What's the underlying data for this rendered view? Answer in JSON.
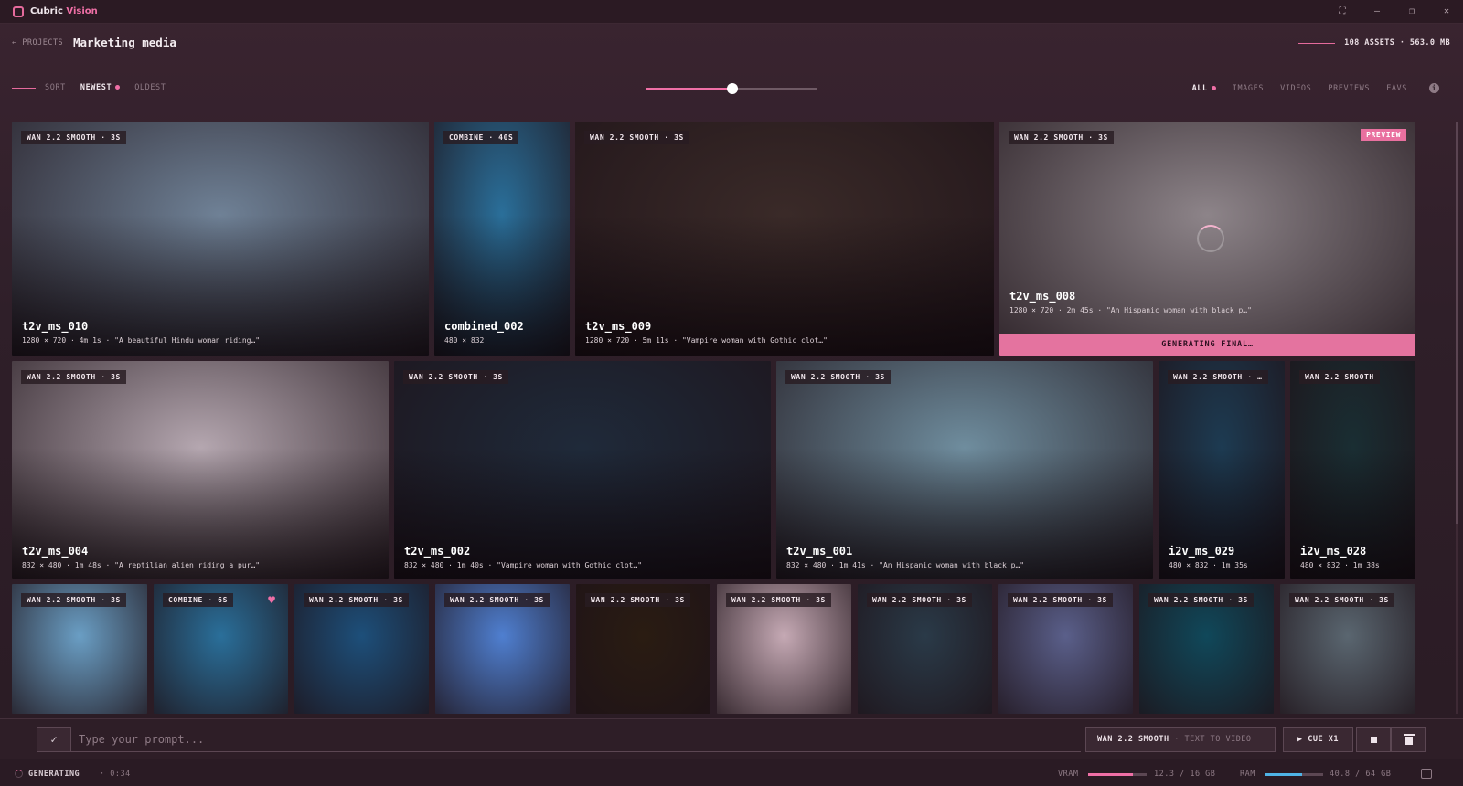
{
  "app": {
    "name_prefix": "Cubric",
    "name_accent": "Vision"
  },
  "header": {
    "back_label": "← PROJECTS",
    "title": "Marketing media",
    "summary": "108 ASSETS · 563.0 MB"
  },
  "sort": {
    "label": "SORT",
    "options": [
      "NEWEST",
      "OLDEST"
    ],
    "active": "NEWEST"
  },
  "thumbnail_size": {
    "value": 0.5
  },
  "filters": {
    "options": [
      "ALL",
      "IMAGES",
      "VIDEOS",
      "PREVIEWS",
      "FAVS"
    ],
    "active": "ALL"
  },
  "tiles": [
    {
      "badge": "WAN 2.2 SMOOTH · 3S",
      "name": "t2v_ms_010",
      "meta": "1280 × 720 · 4m 1s · \"A beautiful Hindu woman riding…\"",
      "bg": "#6f8196"
    },
    {
      "badge": "COMBINE · 40S",
      "name": "combined_002",
      "meta": "480 × 832",
      "bg": "#2a6f9a"
    },
    {
      "badge": "WAN 2.2 SMOOTH · 3S",
      "name": "t2v_ms_009",
      "meta": "1280 × 720 · 5m 11s · \"Vampire woman with Gothic clot…\"",
      "bg": "#3a2a28"
    },
    {
      "badge": "WAN 2.2 SMOOTH · 3S",
      "name": "t2v_ms_008",
      "meta": "1280 × 720 · 2m 45s · \"An Hispanic woman with black p…\"",
      "bg": "#8d8489",
      "preview_tag": "PREVIEW",
      "status_bar": "GENERATING FINAL…"
    },
    {
      "badge": "WAN 2.2 SMOOTH · 3S",
      "name": "t2v_ms_004",
      "meta": "832 × 480 · 1m 48s · \"A reptilian alien riding a pur…\"",
      "bg": "#b5a7b0"
    },
    {
      "badge": "WAN 2.2 SMOOTH · 3S",
      "name": "t2v_ms_002",
      "meta": "832 × 480 · 1m 40s · \"Vampire woman with Gothic clot…\"",
      "bg": "#1f2a3a"
    },
    {
      "badge": "WAN 2.2 SMOOTH · 3S",
      "name": "t2v_ms_001",
      "meta": "832 × 480 · 1m 41s · \"An Hispanic woman with black p…\"",
      "bg": "#6f8d9e"
    },
    {
      "badge": "WAN 2.2 SMOOTH · …",
      "name": "i2v_ms_029",
      "meta": "480 × 832 · 1m 35s",
      "bg": "#1d3b52"
    },
    {
      "badge": "WAN 2.2 SMOOTH",
      "name": "i2v_ms_028",
      "meta": "480 × 832 · 1m 38s",
      "bg": "#1a2e33"
    },
    {
      "badge": "WAN 2.2 SMOOTH · 3S",
      "bg": "#6a9ec4"
    },
    {
      "badge": "COMBINE · 6S",
      "bg": "#2a6f9a",
      "favorite": true
    },
    {
      "badge": "WAN 2.2 SMOOTH · 3S",
      "bg": "#1d4f7a"
    },
    {
      "badge": "WAN 2.2 SMOOTH · 3S",
      "bg": "#4f7fd0"
    },
    {
      "badge": "WAN 2.2 SMOOTH · 3S",
      "bg": "#2a1c12"
    },
    {
      "badge": "WAN 2.2 SMOOTH · 3S",
      "bg": "#c5a9b4"
    },
    {
      "badge": "WAN 2.2 SMOOTH · 3S",
      "bg": "#2a3a48"
    },
    {
      "badge": "WAN 2.2 SMOOTH · 3S",
      "bg": "#5a5f8a"
    },
    {
      "badge": "WAN 2.2 SMOOTH · 3S",
      "bg": "#10485a"
    },
    {
      "badge": "WAN 2.2 SMOOTH · 3S",
      "bg": "#5a6670"
    }
  ],
  "prompt": {
    "placeholder": "Type your prompt...",
    "model": "WAN 2.2 SMOOTH",
    "mode": "· TEXT TO VIDEO",
    "queue_label": "▶ CUE X1"
  },
  "status": {
    "state": "GENERATING",
    "elapsed": "· 0:34",
    "vram_label": "VRAM",
    "vram_value": "12.3 / 16 GB",
    "vram_fraction": 0.77,
    "ram_label": "RAM",
    "ram_value": "40.8 / 64 GB",
    "ram_fraction": 0.64
  },
  "colors": {
    "accent": "#ef6fa6",
    "vram_meter": "#ef6fa6",
    "ram_meter": "#4fb3e6"
  }
}
